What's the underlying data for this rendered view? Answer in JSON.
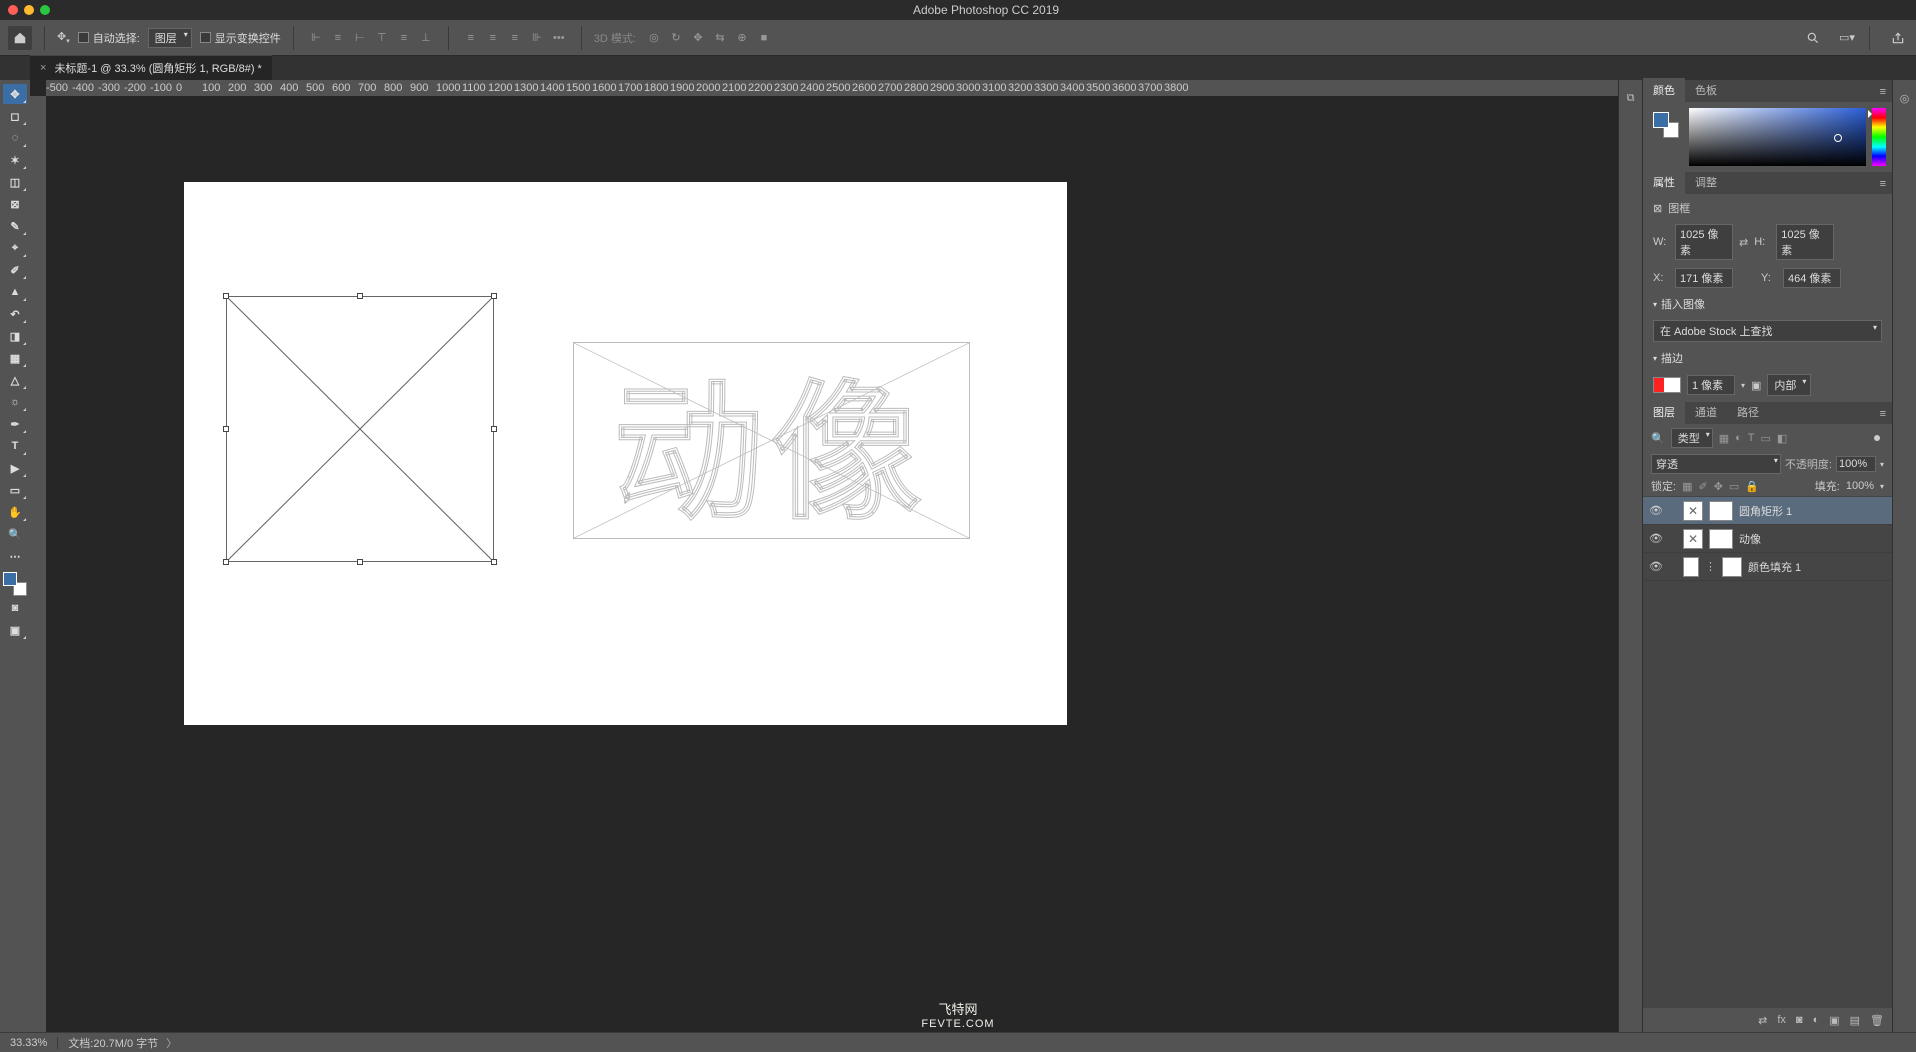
{
  "app": {
    "title": "Adobe Photoshop CC 2019"
  },
  "options": {
    "auto_select_label": "自动选择:",
    "target_select": "图层",
    "show_transform_label": "显示变换控件",
    "mode_3d_label": "3D 模式:"
  },
  "doc": {
    "tab_label": "未标题-1 @ 33.3% (圆角矩形 1, RGB/8#) *"
  },
  "ruler_ticks": [
    "-500",
    "-400",
    "-300",
    "-200",
    "-100",
    "0",
    "100",
    "200",
    "300",
    "400",
    "500",
    "600",
    "700",
    "800",
    "900",
    "1000",
    "1100",
    "1200",
    "1300",
    "1400",
    "1500",
    "1600",
    "1700",
    "1800",
    "1900",
    "2000",
    "2100",
    "2200",
    "2300",
    "2400",
    "2500",
    "2600",
    "2700",
    "2800",
    "2900",
    "3000",
    "3100",
    "3200",
    "3300",
    "3400",
    "3500",
    "3600",
    "3700",
    "3800"
  ],
  "canvas": {
    "text_chars": "动像"
  },
  "panels": {
    "color": {
      "tab_color": "颜色",
      "tab_swatches": "色板"
    },
    "props": {
      "tab_props": "属性",
      "tab_adjust": "调整",
      "object_type": "图框",
      "w_label": "W:",
      "w_value": "1025 像素",
      "h_label": "H:",
      "h_value": "1025 像素",
      "x_label": "X:",
      "x_value": "171 像素",
      "y_label": "Y:",
      "y_value": "464 像素",
      "insert_head": "插入图像",
      "insert_select": "在 Adobe Stock 上查找",
      "stroke_head": "描边",
      "stroke_width": "1 像素",
      "stroke_align": "内部"
    },
    "layers": {
      "tab_layers": "图层",
      "tab_channels": "通道",
      "tab_paths": "路径",
      "filter_kind": "类型",
      "blend_mode": "穿透",
      "opacity_label": "不透明度:",
      "opacity_value": "100%",
      "lock_label": "锁定:",
      "fill_label": "填充:",
      "fill_value": "100%",
      "items": [
        {
          "name": "圆角矩形 1"
        },
        {
          "name": "动像"
        },
        {
          "name": "颜色填充 1"
        }
      ]
    }
  },
  "status": {
    "zoom": "33.33%",
    "doc_info": "文档:20.7M/0 字节"
  },
  "watermark": {
    "line1": "飞特网",
    "line2": "FEVTE.COM"
  }
}
